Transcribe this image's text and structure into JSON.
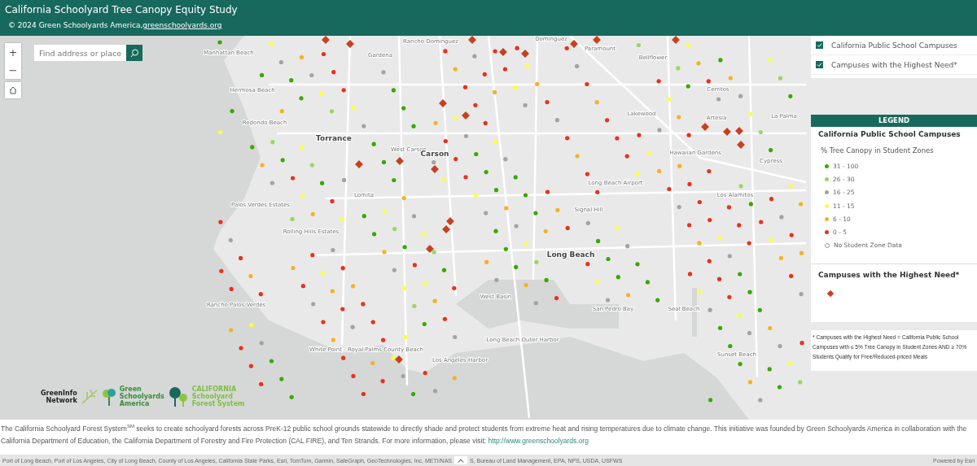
{
  "header": {
    "title": "California Schoolyard Tree Canopy Equity Study",
    "credit": "© 2024 Green Schoolyards America, ",
    "credit_link": "greenschoolyards.org"
  },
  "map_controls": {
    "zoom_in": "+",
    "zoom_out": "−",
    "search": {
      "placeholder": "Find address or place"
    }
  },
  "map": {
    "labels": [
      "Manhattan Beach",
      "Hermosa Beach",
      "Redondo Beach",
      "Torrance",
      "Gardena",
      "Rancho Dominguez",
      "Dominguez",
      "Paramount",
      "Bellflower",
      "Lakewood",
      "Cerritos",
      "Artesia",
      "La Palma",
      "West Carson",
      "Carson",
      "Lomita",
      "Palos Verdes Estates",
      "Rolling Hills Estates",
      "Rancho Palos Verdes",
      "Signal Hill",
      "Long Beach",
      "Long Beach Airport",
      "Hawaiian Gardens",
      "Los Alamitos",
      "Cypress",
      "Seal Beach",
      "Sunset Beach",
      "West Basin",
      "San Pedro Bay",
      "Long Beach Outer Harbor",
      "Los Angeles Harbor",
      "White Point - Royal Palms County Beach"
    ]
  },
  "layers": [
    {
      "label": "California Public School Campuses",
      "checked": true
    },
    {
      "label": "Campuses with the Highest Need*",
      "checked": true
    }
  ],
  "legend": {
    "title": "LEGEND",
    "layer_title": "California Public School Campuses",
    "field": "% Tree Canopy in Student Zones",
    "classes": [
      {
        "label": "31 - 100",
        "color": "#38a800"
      },
      {
        "label": "26 - 30",
        "color": "#98d860"
      },
      {
        "label": "16 - 25",
        "color": "#a3a3a3"
      },
      {
        "label": "11 - 15",
        "color": "#ffff3c"
      },
      {
        "label": "6 - 10",
        "color": "#f5b320"
      },
      {
        "label": "0 - 5",
        "color": "#e8311c"
      },
      {
        "label": "No Student Zone Data",
        "kind": "hollow"
      }
    ],
    "need": {
      "title": "Campuses with the Highest Need*",
      "color": "#c8401e"
    },
    "footnote": "* Campuses with the Highest Need = California Public School Campuses with ≤ 5% Tree Canopy in Student Zones AND ≥ 70% Students Qualify for Free/Reduced-priced Meals"
  },
  "logos": [
    {
      "lines": [
        "GreenInfo",
        "Network"
      ]
    },
    {
      "lines": [
        "Green",
        "Schoolyards",
        "America"
      ]
    },
    {
      "lines": [
        "CALIFORNIA",
        "Schoolyard",
        "Forest System"
      ]
    }
  ],
  "description": {
    "text": "The California Schoolyard Forest System$^{SM}$ seeks to create schoolyard forests across PreK-12 public school grounds statewide to directly shade and protect students from extreme heat and rising temperatures due to climate change. This initiative was founded by Green Schoolyards America in collaboration with the California Department of Education, the California Department of Forestry and Fire Protection (CAL FIRE), and Ten Strands. For more information, please visit: ",
    "link": "http://www.greenschoolyards.org"
  },
  "attribution": {
    "left": "Port of Long Beach, Port of Los Angeles, City of Long Beach, County of Los Angeles, California State Parks, Esri, TomTom, Garmin, SafeGraph, GeoTechnologies, Inc, METI/NAS",
    "right": "S, Bureau of Land Management, EPA, NPS, USDA, USFWS",
    "powered": "Powered by Esri"
  }
}
